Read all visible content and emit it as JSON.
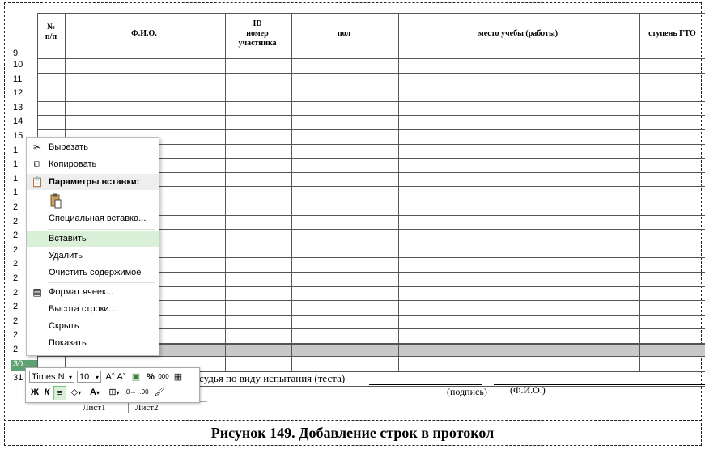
{
  "sheet": {
    "columns": {
      "num": "№\nп/п",
      "fio": "Ф.И.О.",
      "id": "ID\nномер\nучастника",
      "sex": "пол",
      "place": "место учебы (работы)",
      "gto": "ступень ГТО"
    },
    "header_row": "9",
    "rows": [
      "10",
      "11",
      "12",
      "13",
      "14",
      "15",
      "1",
      "1",
      "1",
      "1",
      "2",
      "2",
      "2",
      "2",
      "2",
      "2",
      "2",
      "2",
      "2",
      "2",
      "2",
      "30",
      "31"
    ],
    "selected_row": "30"
  },
  "signature": {
    "line_text": "судья по виду испытания (теста)",
    "podpis": "(подпись)",
    "fio": "(Ф.И.О.)"
  },
  "sheet_tabs": [
    "Лист1",
    "Лист2"
  ],
  "context_menu": {
    "cut": "Вырезать",
    "copy": "Копировать",
    "paste_options": "Параметры вставки:",
    "paste_special": "Специальная вставка...",
    "insert": "Вставить",
    "delete": "Удалить",
    "clear": "Очистить содержимое",
    "format_cells": "Формат ячеек...",
    "row_height": "Высота строки...",
    "hide": "Скрыть",
    "show": "Показать"
  },
  "mini_toolbar": {
    "font_name": "Times N",
    "font_size": "10",
    "percent": "%",
    "thousands": "000",
    "bold": "Ж",
    "italic": "К"
  },
  "caption": "Рисунок 149. Добавление строк в протокол",
  "colors": {
    "highlight": "#d9efd8",
    "selected_row": "#5ea274"
  }
}
